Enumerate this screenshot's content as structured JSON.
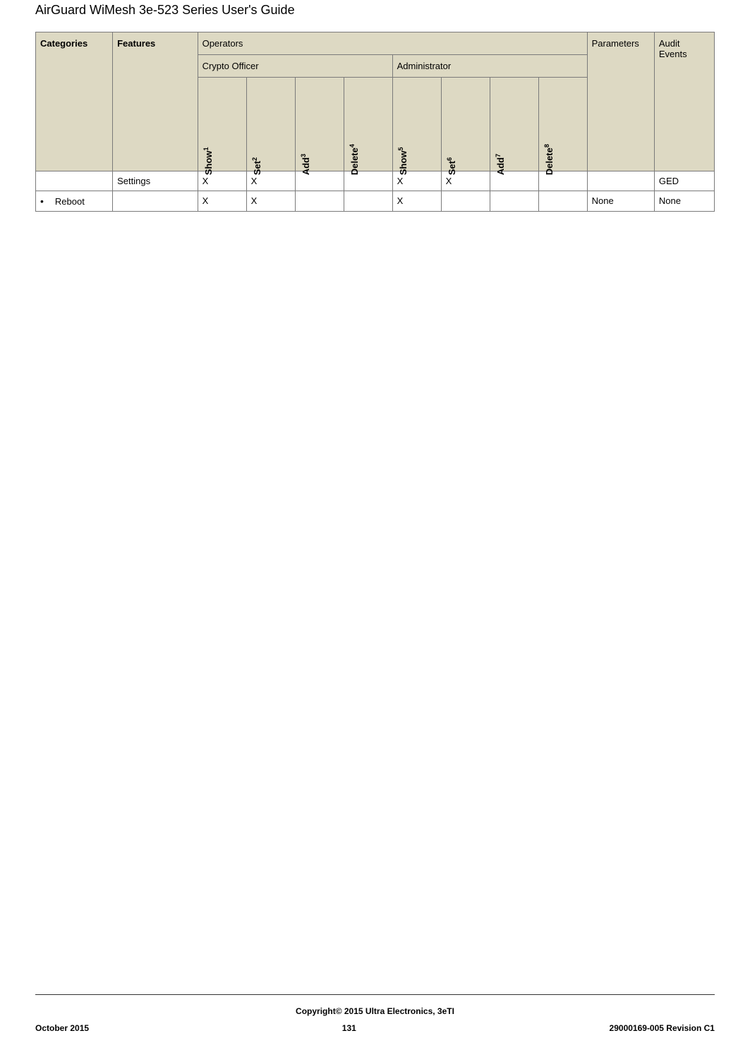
{
  "docTitle": "AirGuard WiMesh 3e-523 Series User's Guide",
  "header": {
    "categories": "Categories",
    "features": "Features",
    "operators": "Operators",
    "parameters": "Parameters",
    "auditEvents": "Audit Events",
    "cryptoOfficer": "Crypto Officer",
    "administrator": "Administrator",
    "cols": {
      "show1": "Show",
      "show1sup": "1",
      "set2": "Set",
      "set2sup": "2",
      "add3": "Add",
      "add3sup": "3",
      "delete4": "Delete",
      "delete4sup": "4",
      "show5": "Show",
      "show5sup": "5",
      "set6": "Set",
      "set6sup": "6",
      "add7": "Add",
      "add7sup": "7",
      "delete8": "Delete",
      "delete8sup": "8"
    }
  },
  "rows": [
    {
      "category": "",
      "feature": "Settings",
      "c1": "X",
      "c2": "X",
      "c3": "",
      "c4": "",
      "c5": "X",
      "c6": "X",
      "c7": "",
      "c8": "",
      "parameters": "",
      "audit": "GED"
    },
    {
      "category": "Reboot",
      "feature": "",
      "c1": "X",
      "c2": "X",
      "c3": "",
      "c4": "",
      "c5": "X",
      "c6": "",
      "c7": "",
      "c8": "",
      "parameters": "None",
      "audit": "None"
    }
  ],
  "footer": {
    "copyright": "Copyright© 2015 Ultra Electronics, 3eTI",
    "left": "October 2015",
    "center": "131",
    "right": "29000169-005 Revision C1"
  }
}
